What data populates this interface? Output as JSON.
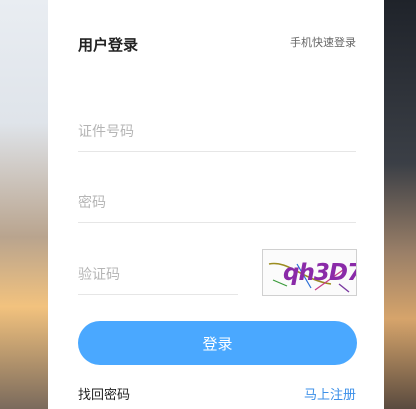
{
  "header": {
    "title": "用户登录",
    "quick_login": "手机快速登录"
  },
  "form": {
    "id_placeholder": "证件号码",
    "password_placeholder": "密码",
    "captcha_placeholder": "验证码",
    "captcha_text": "qh3D7",
    "login_label": "登录"
  },
  "footer": {
    "forgot_label": "找回密码",
    "register_label": "马上注册"
  },
  "colors": {
    "accent": "#4aa8ff",
    "link": "#3b8fe8"
  }
}
